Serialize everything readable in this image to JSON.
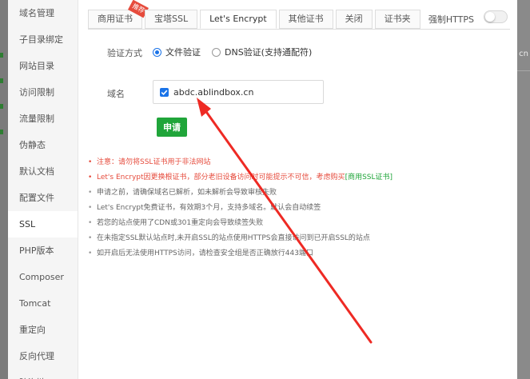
{
  "sidebar": {
    "items": [
      {
        "label": "域名管理",
        "active": false
      },
      {
        "label": "子目录绑定",
        "active": false
      },
      {
        "label": "网站目录",
        "active": false
      },
      {
        "label": "访问限制",
        "active": false
      },
      {
        "label": "流量限制",
        "active": false
      },
      {
        "label": "伪静态",
        "active": false
      },
      {
        "label": "默认文档",
        "active": false
      },
      {
        "label": "配置文件",
        "active": false
      },
      {
        "label": "SSL",
        "active": true
      },
      {
        "label": "PHP版本",
        "active": false
      },
      {
        "label": "Composer",
        "active": false
      },
      {
        "label": "Tomcat",
        "active": false
      },
      {
        "label": "重定向",
        "active": false
      },
      {
        "label": "反向代理",
        "active": false
      },
      {
        "label": "防盗链",
        "active": false
      }
    ]
  },
  "tabs": [
    {
      "label": "商用证书",
      "active": false,
      "badge": "推荐"
    },
    {
      "label": "宝塔SSL",
      "active": false
    },
    {
      "label": "Let's Encrypt",
      "active": true
    },
    {
      "label": "其他证书",
      "active": false
    },
    {
      "label": "关闭",
      "active": false
    },
    {
      "label": "证书夹",
      "active": false
    }
  ],
  "force_https": {
    "label": "强制HTTPS",
    "enabled": false
  },
  "verify": {
    "label": "验证方式",
    "options": [
      {
        "label": "文件验证",
        "checked": true
      },
      {
        "label": "DNS验证(支持通配符)",
        "checked": false
      }
    ]
  },
  "domain": {
    "label": "域名",
    "items": [
      {
        "name": "abdc.ablindbox.cn",
        "checked": true
      }
    ]
  },
  "apply_button": "申请",
  "notes": [
    {
      "text": "注意：请勿将SSL证书用于非法网站",
      "warn": true
    },
    {
      "text": "Let's Encrypt因更换根证书，部分老旧设备访问时可能提示不可信，考虑购买",
      "link": "[商用SSL证书]",
      "warn": true
    },
    {
      "text": "申请之前，请确保域名已解析，如未解析会导致审核失败",
      "warn": false
    },
    {
      "text": "Let's Encrypt免费证书，有效期3个月，支持多域名。默认会自动续签",
      "warn": false
    },
    {
      "text": "若您的站点使用了CDN或301重定向会导致续签失败",
      "warn": false
    },
    {
      "text": "在未指定SSL默认站点时,未开启SSL的站点使用HTTPS会直接访问到已开启SSL的站点",
      "warn": false
    },
    {
      "text": "如开启后无法使用HTTPS访问，请检查安全组是否正确放行443端口",
      "warn": false
    }
  ],
  "backdrop_fragment": "cn",
  "colors": {
    "accent": "#20a53a",
    "primary": "#1a73e8",
    "warning": "#e64b3c",
    "arrow": "#ee2a24"
  }
}
